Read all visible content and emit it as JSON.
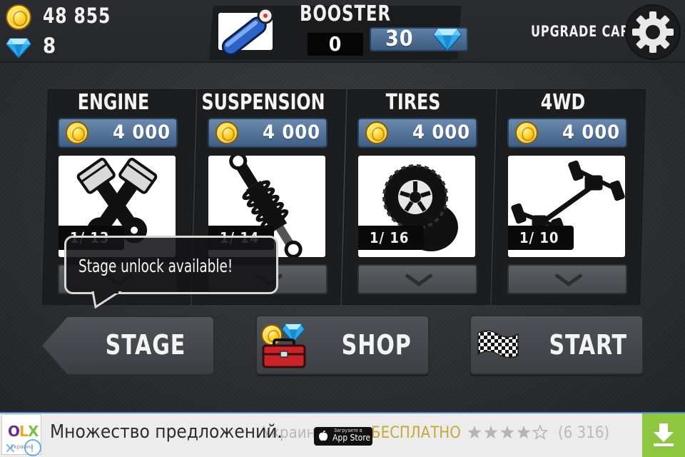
{
  "hud": {
    "coins": "48 855",
    "gems": "8"
  },
  "booster": {
    "title": "BOOSTER",
    "count": "0",
    "price": "30"
  },
  "header": {
    "upgrade_label": "UPGRADE CAR"
  },
  "upgrades": [
    {
      "name": "ENGINE",
      "price": "4 000",
      "level": "1/ 13",
      "icon": "engine-pistons-icon"
    },
    {
      "name": "SUSPENSION",
      "price": "4 000",
      "level": "1/ 14",
      "icon": "suspension-shock-icon"
    },
    {
      "name": "TIRES",
      "price": "4 000",
      "level": "1/ 16",
      "icon": "tire-icon"
    },
    {
      "name": "4WD",
      "price": "4 000",
      "level": "1/ 10",
      "icon": "drivetrain-4wd-icon"
    }
  ],
  "tooltip": {
    "text": "Stage unlock available!"
  },
  "buttons": {
    "stage": "STAGE",
    "shop": "SHOP",
    "start": "START"
  },
  "ad": {
    "brand": "OLX",
    "brand_sub": "Украина",
    "headline": "Множество предложений.",
    "faded_left": "Украина",
    "faded_free": "БЕСПЛАТНО",
    "rating_count": "(6 316)",
    "rating_stars": 4,
    "appstore_small": "Загрузите в",
    "appstore_big": "App Store"
  },
  "colors": {
    "price_pill": "#4f6f95",
    "download_green": "#8ec63f",
    "ad_border": "#4d84d6"
  }
}
